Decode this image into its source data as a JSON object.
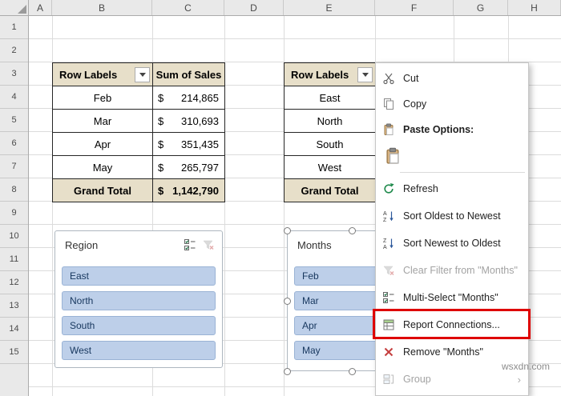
{
  "watermark": "wsxdn.com",
  "grid": {
    "columns": [
      "A",
      "B",
      "C",
      "D",
      "E",
      "F",
      "G",
      "H"
    ],
    "rows": [
      "1",
      "2",
      "3",
      "4",
      "5",
      "6",
      "7",
      "8",
      "9",
      "10",
      "11",
      "12",
      "13",
      "14",
      "15"
    ]
  },
  "pivot_left": {
    "col1_header": "Row Labels",
    "col2_header": "Sum of Sales",
    "rows": [
      {
        "label": "Feb",
        "cur": "$",
        "val": "214,865"
      },
      {
        "label": "Mar",
        "cur": "$",
        "val": "310,693"
      },
      {
        "label": "Apr",
        "cur": "$",
        "val": "351,435"
      },
      {
        "label": "May",
        "cur": "$",
        "val": "265,797"
      }
    ],
    "total": {
      "label": "Grand Total",
      "cur": "$",
      "val": "1,142,790"
    }
  },
  "pivot_right": {
    "col1_header": "Row Labels",
    "rows": [
      "East",
      "North",
      "South",
      "West"
    ],
    "total": "Grand Total"
  },
  "slicer_region": {
    "title": "Region",
    "items": [
      "East",
      "North",
      "South",
      "West"
    ]
  },
  "slicer_months": {
    "title": "Months",
    "items": [
      "Feb",
      "Mar",
      "Apr",
      "May"
    ]
  },
  "context_menu": {
    "cut": "Cut",
    "copy": "Copy",
    "paste_options": "Paste Options:",
    "refresh": "Refresh",
    "sort_old_new": "Sort Oldest to Newest",
    "sort_new_old": "Sort Newest to Oldest",
    "clear_filter": "Clear Filter from \"Months\"",
    "multi_select": "Multi-Select \"Months\"",
    "report_connections": "Report Connections...",
    "remove": "Remove \"Months\"",
    "group": "Group",
    "group_submenu_chevron": "›"
  },
  "colors": {
    "annotation_red": "#DE0000",
    "slicer_item_fill": "#BDCFE9",
    "pivot_header_tan": "#E7DFC9"
  }
}
